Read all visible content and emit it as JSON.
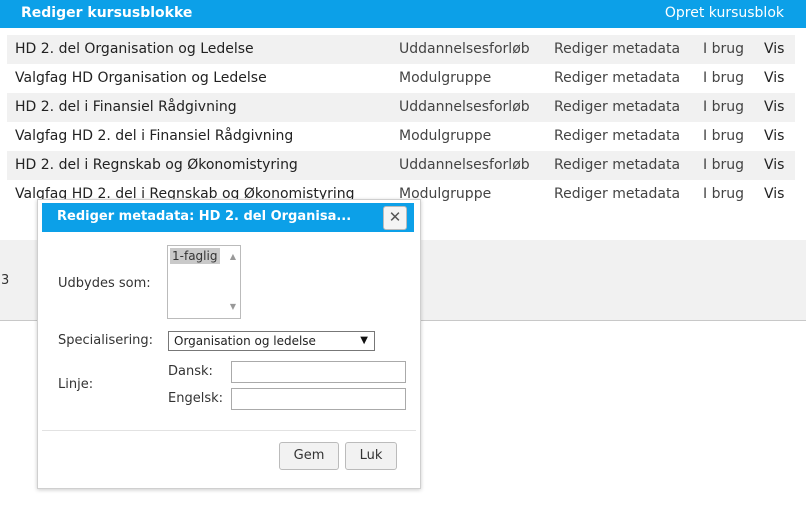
{
  "header": {
    "title": "Rediger kursusblokke",
    "create_link": "Opret kursusblok"
  },
  "rows": [
    {
      "name": "HD 2. del Organisation og Ledelse",
      "type": "Uddannelsesforløb",
      "edit": "Rediger metadata",
      "status": "I brug",
      "view": "Vis"
    },
    {
      "name": "Valgfag HD Organisation og Ledelse",
      "type": "Modulgruppe",
      "edit": "Rediger metadata",
      "status": "I brug",
      "view": "Vis"
    },
    {
      "name": "HD 2. del i Finansiel Rådgivning",
      "type": "Uddannelsesforløb",
      "edit": "Rediger metadata",
      "status": "I brug",
      "view": "Vis"
    },
    {
      "name": "Valgfag HD 2. del i Finansiel Rådgivning",
      "type": "Modulgruppe",
      "edit": "Rediger metadata",
      "status": "I brug",
      "view": "Vis"
    },
    {
      "name": "HD 2. del i Regnskab og Økonomistyring",
      "type": "Uddannelsesforløb",
      "edit": "Rediger metadata",
      "status": "I brug",
      "view": "Vis"
    },
    {
      "name": "Valgfag HD 2. del i Regnskab og Økonomistyring",
      "type": "Modulgruppe",
      "edit": "Rediger metadata",
      "status": "I brug",
      "view": "Vis"
    }
  ],
  "background": {
    "partial_number": "3"
  },
  "dialog": {
    "title": "Rediger metadata: HD 2. del Organisa...",
    "close_icon": "close-icon",
    "offered_as_label": "Udbydes som:",
    "offered_as_options": [
      "1-faglig"
    ],
    "specialization_label": "Specialisering:",
    "specialization_value": "Organisation og ledelse",
    "line_label": "Linje:",
    "danish_label": "Dansk:",
    "danish_value": "",
    "english_label": "Engelsk:",
    "english_value": "",
    "save_label": "Gem",
    "close_label": "Luk"
  },
  "colors": {
    "accent": "#0ca0e8",
    "row_alt": "#f1f1f1"
  }
}
